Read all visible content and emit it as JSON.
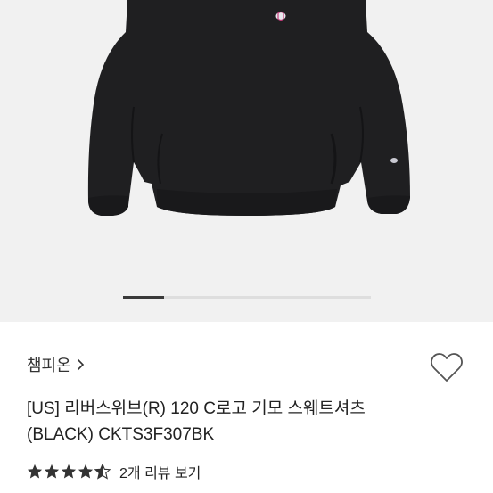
{
  "product": {
    "brand": "챔피온",
    "title_line1": "[US] 리버스위브(R) 120 C로고 기모 스웨트셔츠",
    "title_line2": "(BLACK) CKTS3F307BK",
    "rating": 4.5,
    "reviews_link": "2개 리뷰 보기"
  },
  "gallery": {
    "current_image": 1,
    "progress_fraction": 0.166
  },
  "colors": {
    "gallery_bg": "#f1f1f1",
    "garment": "#1f1f21",
    "text": "#222222"
  },
  "icons": {
    "brand_chevron": "chevron-right-icon",
    "wishlist": "heart-outline-icon",
    "star": "star-filled-icon"
  }
}
